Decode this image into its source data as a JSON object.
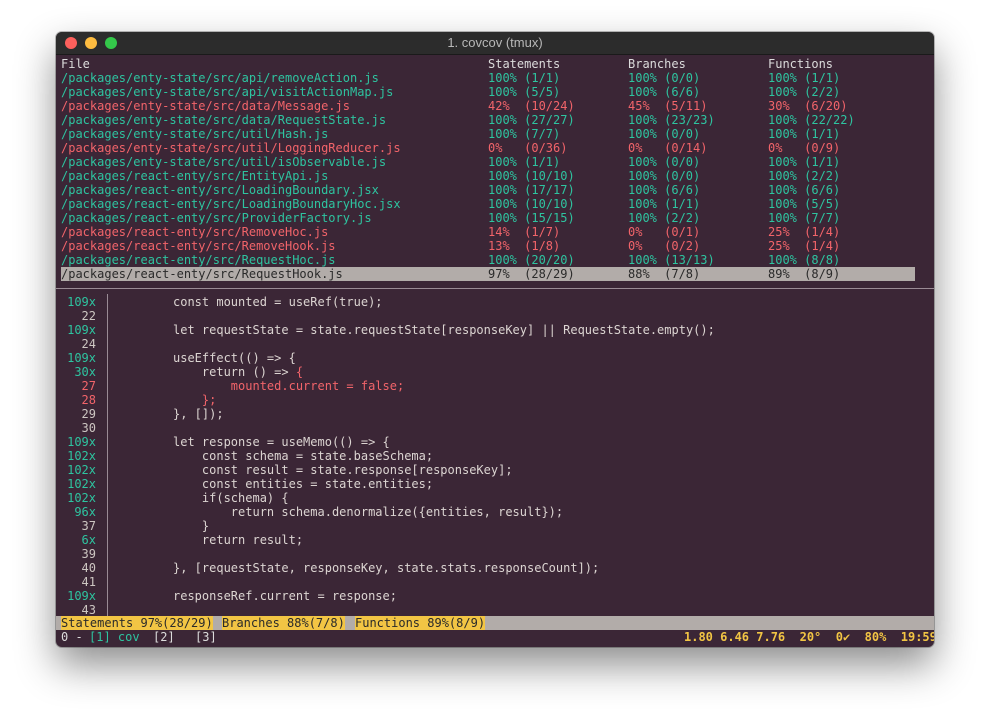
{
  "window": {
    "title": "1. covcov (tmux)"
  },
  "table": {
    "headers": {
      "file": "File",
      "statements": "Statements",
      "branches": "Branches",
      "functions": "Functions"
    },
    "rows": [
      {
        "file": "/packages/enty-state/src/api/removeAction.js",
        "statements": "100% (1/1)",
        "branches": "100% (0/0)",
        "functions": "100% (1/1)",
        "status": "ok"
      },
      {
        "file": "/packages/enty-state/src/api/visitActionMap.js",
        "statements": "100% (5/5)",
        "branches": "100% (6/6)",
        "functions": "100% (2/2)",
        "status": "ok"
      },
      {
        "file": "/packages/enty-state/src/data/Message.js",
        "statements": "42%  (10/24)",
        "branches": "45%  (5/11)",
        "functions": "30%  (6/20)",
        "status": "bad"
      },
      {
        "file": "/packages/enty-state/src/data/RequestState.js",
        "statements": "100% (27/27)",
        "branches": "100% (23/23)",
        "functions": "100% (22/22)",
        "status": "ok"
      },
      {
        "file": "/packages/enty-state/src/util/Hash.js",
        "statements": "100% (7/7)",
        "branches": "100% (0/0)",
        "functions": "100% (1/1)",
        "status": "ok"
      },
      {
        "file": "/packages/enty-state/src/util/LoggingReducer.js",
        "statements": "0%   (0/36)",
        "branches": "0%   (0/14)",
        "functions": "0%   (0/9)",
        "status": "bad"
      },
      {
        "file": "/packages/enty-state/src/util/isObservable.js",
        "statements": "100% (1/1)",
        "branches": "100% (0/0)",
        "functions": "100% (1/1)",
        "status": "ok"
      },
      {
        "file": "/packages/react-enty/src/EntityApi.js",
        "statements": "100% (10/10)",
        "branches": "100% (0/0)",
        "functions": "100% (2/2)",
        "status": "ok"
      },
      {
        "file": "/packages/react-enty/src/LoadingBoundary.jsx",
        "statements": "100% (17/17)",
        "branches": "100% (6/6)",
        "functions": "100% (6/6)",
        "status": "ok"
      },
      {
        "file": "/packages/react-enty/src/LoadingBoundaryHoc.jsx",
        "statements": "100% (10/10)",
        "branches": "100% (1/1)",
        "functions": "100% (5/5)",
        "status": "ok"
      },
      {
        "file": "/packages/react-enty/src/ProviderFactory.js",
        "statements": "100% (15/15)",
        "branches": "100% (2/2)",
        "functions": "100% (7/7)",
        "status": "ok"
      },
      {
        "file": "/packages/react-enty/src/RemoveHoc.js",
        "statements": "14%  (1/7)",
        "branches": "0%   (0/1)",
        "functions": "25%  (1/4)",
        "status": "bad"
      },
      {
        "file": "/packages/react-enty/src/RemoveHook.js",
        "statements": "13%  (1/8)",
        "branches": "0%   (0/2)",
        "functions": "25%  (1/4)",
        "status": "bad"
      },
      {
        "file": "/packages/react-enty/src/RequestHoc.js",
        "statements": "100% (20/20)",
        "branches": "100% (13/13)",
        "functions": "100% (8/8)",
        "status": "ok"
      },
      {
        "file": "/packages/react-enty/src/RequestHook.js",
        "statements": "97%  (28/29)",
        "branches": "88%  (7/8)",
        "functions": "89%  (8/9)",
        "status": "selected"
      }
    ]
  },
  "code": {
    "lines": [
      {
        "count": "109x",
        "code": "const mounted = useRef(true);",
        "kind": "hit"
      },
      {
        "count": "22",
        "code": "",
        "kind": "num"
      },
      {
        "count": "109x",
        "code": "let requestState = state.requestState[responseKey] || RequestState.empty();",
        "kind": "hit"
      },
      {
        "count": "24",
        "code": "",
        "kind": "num"
      },
      {
        "count": "109x",
        "code": "useEffect(() => {",
        "kind": "hit"
      },
      {
        "count": "30x",
        "code": "    return () => {",
        "kind": "hit",
        "tail": "{"
      },
      {
        "count": "27",
        "code": "        mounted.current = false;",
        "kind": "miss"
      },
      {
        "count": "28",
        "code": "    };",
        "kind": "miss"
      },
      {
        "count": "29",
        "code": "}, []);",
        "kind": "num"
      },
      {
        "count": "30",
        "code": "",
        "kind": "num"
      },
      {
        "count": "109x",
        "code": "let response = useMemo(() => {",
        "kind": "hit"
      },
      {
        "count": "102x",
        "code": "    const schema = state.baseSchema;",
        "kind": "hit"
      },
      {
        "count": "102x",
        "code": "    const result = state.response[responseKey];",
        "kind": "hit"
      },
      {
        "count": "102x",
        "code": "    const entities = state.entities;",
        "kind": "hit"
      },
      {
        "count": "102x",
        "code": "    if(schema) {",
        "kind": "hit"
      },
      {
        "count": "96x",
        "code": "        return schema.denormalize({entities, result});",
        "kind": "hit"
      },
      {
        "count": "37",
        "code": "    }",
        "kind": "num"
      },
      {
        "count": "6x",
        "code": "    return result;",
        "kind": "hit"
      },
      {
        "count": "39",
        "code": "",
        "kind": "num"
      },
      {
        "count": "40",
        "code": "}, [requestState, responseKey, state.stats.responseCount]);",
        "kind": "num"
      },
      {
        "count": "41",
        "code": "",
        "kind": "num"
      },
      {
        "count": "109x",
        "code": "responseRef.current = response;",
        "kind": "hit"
      },
      {
        "count": "43",
        "code": "",
        "kind": "num"
      }
    ]
  },
  "status": {
    "statements": "Statements 97%(28/29)",
    "branches": "Branches 88%(7/8)",
    "functions": "Functions 89%(8/9)"
  },
  "tmux": {
    "session": "0 -",
    "win1": "[1] cov",
    "win2": "[2]",
    "win3": "[3]",
    "right": "1.80 6.46 7.76  20°  0✔  80%  19:59"
  },
  "colors": {
    "background": "#3b2636",
    "covered": "#2ec4a0",
    "uncovered": "#f2646a",
    "highlight": "#f2c544"
  }
}
